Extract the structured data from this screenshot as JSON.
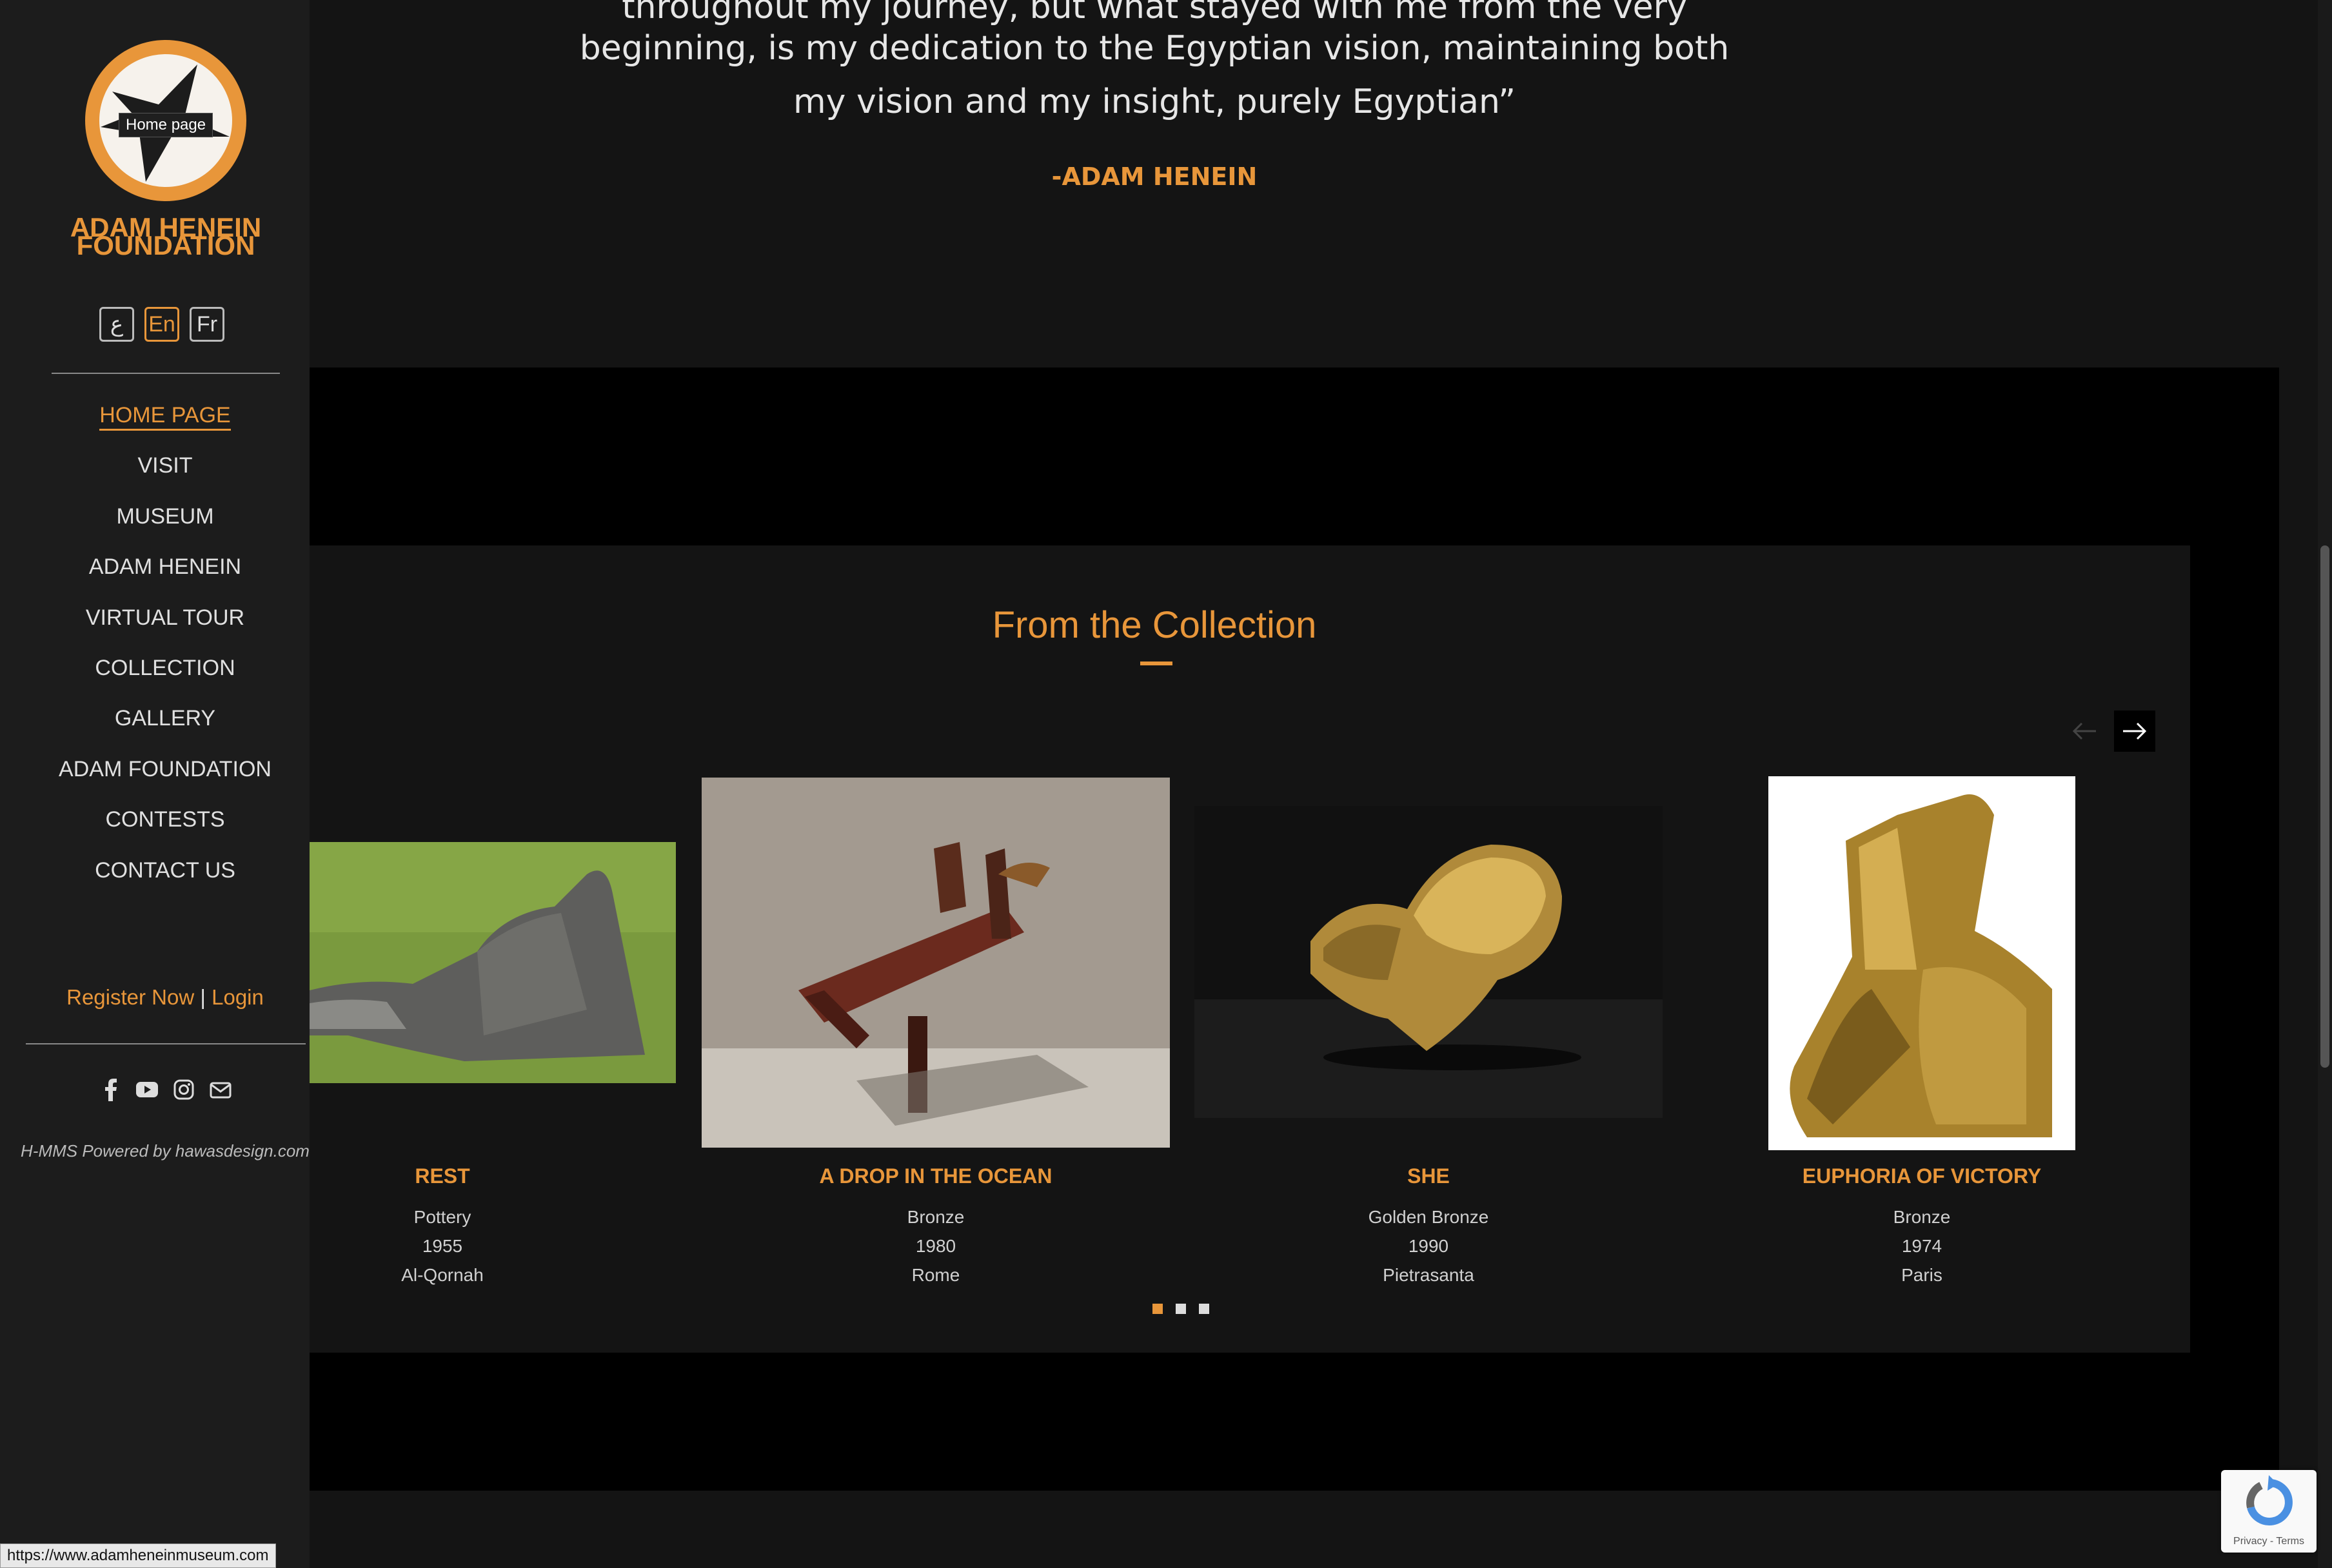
{
  "sidebar": {
    "logo_tooltip": "Home page",
    "brand_line1": "ADAM HENEIN",
    "brand_line2": "FOUNDATION",
    "languages": [
      "ع",
      "En",
      "Fr"
    ],
    "nav": [
      {
        "label": "HOME PAGE",
        "active": true
      },
      {
        "label": "VISIT"
      },
      {
        "label": "MUSEUM"
      },
      {
        "label": "ADAM HENEIN"
      },
      {
        "label": "VIRTUAL TOUR"
      },
      {
        "label": "COLLECTION"
      },
      {
        "label": "GALLERY"
      },
      {
        "label": "ADAM FOUNDATION"
      },
      {
        "label": "CONTESTS"
      },
      {
        "label": "CONTACT US"
      }
    ],
    "register": "Register Now",
    "separator": "|",
    "login": "Login",
    "social_icons": [
      "facebook-icon",
      "youtube-icon",
      "instagram-icon",
      "email-icon"
    ],
    "powered": "H-MMS Powered by hawasdesign.com"
  },
  "quote": {
    "line1": "throughout my journey, but what stayed with me from the very",
    "line2": "beginning, is my dedication to the Egyptian vision, maintaining both",
    "line3": "my vision and my insight, purely Egyptian”",
    "author": "-ADAM HENEIN"
  },
  "collection": {
    "title": "From the Collection",
    "items": [
      {
        "title": "REST",
        "material": "Pottery",
        "year": "1955",
        "place": "Al-Qornah"
      },
      {
        "title": "A DROP IN THE OCEAN",
        "material": "Bronze",
        "year": "1980",
        "place": "Rome"
      },
      {
        "title": "SHE",
        "material": "Golden Bronze",
        "year": "1990",
        "place": "Pietrasanta"
      },
      {
        "title": "EUPHORIA OF VICTORY",
        "material": "Bronze",
        "year": "1974",
        "place": "Paris"
      }
    ],
    "pages": 3,
    "active_page": 1
  },
  "status_bar": {
    "url": "https://www.adamheneinmuseum.com"
  },
  "recaptcha": {
    "text": "Privacy - Terms"
  },
  "colors": {
    "accent": "#e8963a",
    "sidebar_bg": "#1c1c1c",
    "page_bg": "#141414"
  }
}
